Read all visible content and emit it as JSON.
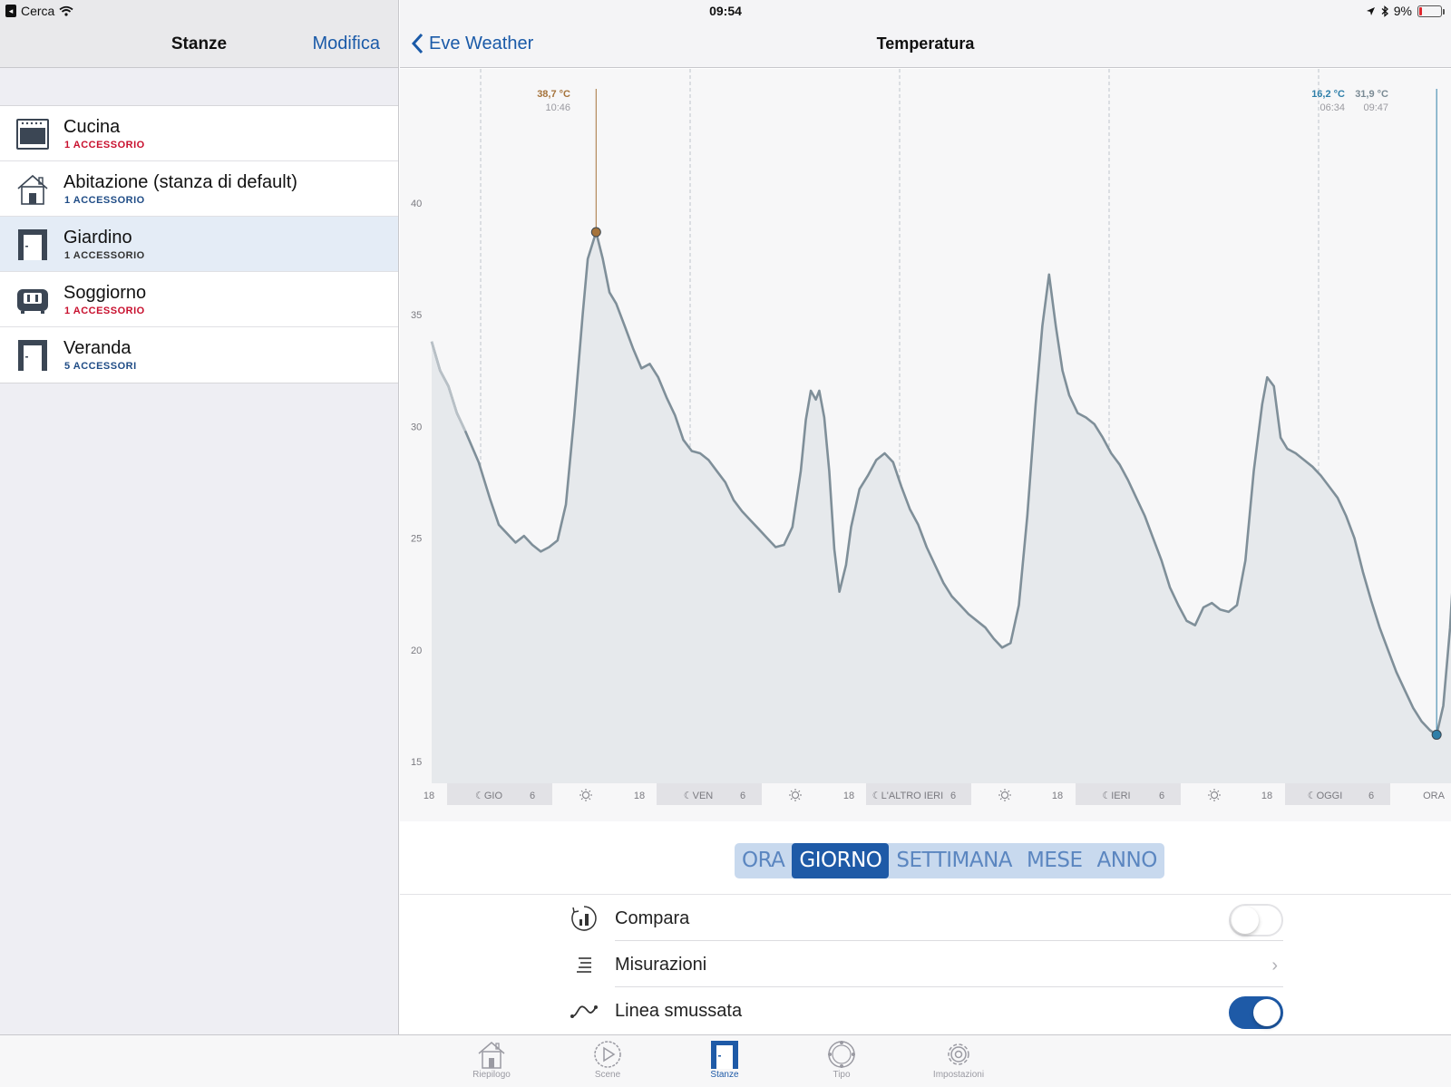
{
  "status": {
    "carrier_back": "Cerca",
    "time": "09:54",
    "battery_pct": "9%"
  },
  "left": {
    "title": "Stanze",
    "edit": "Modifica",
    "rooms": [
      {
        "name": "Cucina",
        "sub": "1 ACCESSORIO",
        "icon": "oven-icon"
      },
      {
        "name": "Abitazione (stanza di default)",
        "sub": "1 ACCESSORIO",
        "icon": "house-icon"
      },
      {
        "name": "Giardino",
        "sub": "1 ACCESSORIO",
        "icon": "door-icon"
      },
      {
        "name": "Soggiorno",
        "sub": "1 ACCESSORIO",
        "icon": "sofa-icon"
      },
      {
        "name": "Veranda",
        "sub": "5 ACCESSORI",
        "icon": "door-icon"
      }
    ]
  },
  "right": {
    "back_label": "Eve Weather",
    "title": "Temperatura"
  },
  "chart_data": {
    "type": "area",
    "ylim": [
      14,
      45
    ],
    "yticks": [
      15,
      20,
      25,
      30,
      35,
      40
    ],
    "x_labels": [
      "18",
      "GIO",
      "6",
      "18",
      "VEN",
      "6",
      "18",
      "L'ALTRO IERI",
      "6",
      "18",
      "IERI",
      "6",
      "18",
      "OGGI",
      "6",
      "ORA"
    ],
    "x_unit": "hours",
    "series": [
      {
        "values": [
          [
            0,
            33.8
          ],
          [
            0.5,
            32.5
          ],
          [
            1,
            31.8
          ],
          [
            1.5,
            30.6
          ],
          [
            2,
            29.8
          ],
          [
            2.8,
            28.4
          ],
          [
            3.5,
            26.7
          ],
          [
            4,
            25.6
          ],
          [
            4.5,
            25.2
          ],
          [
            5,
            24.8
          ],
          [
            5.5,
            25.1
          ],
          [
            6,
            24.7
          ],
          [
            6.5,
            24.4
          ],
          [
            7,
            24.6
          ],
          [
            7.5,
            24.9
          ],
          [
            8,
            26.5
          ],
          [
            8.5,
            30.5
          ],
          [
            9,
            35
          ],
          [
            9.3,
            37.5
          ],
          [
            9.8,
            38.7
          ],
          [
            10.2,
            37.5
          ],
          [
            10.6,
            36
          ],
          [
            11,
            35.5
          ],
          [
            11.5,
            34.5
          ],
          [
            12,
            33.5
          ],
          [
            12.5,
            32.6
          ],
          [
            13,
            32.8
          ],
          [
            13.5,
            32.2
          ],
          [
            14,
            31.3
          ],
          [
            14.5,
            30.5
          ],
          [
            15,
            29.4
          ],
          [
            15.5,
            28.9
          ],
          [
            16,
            28.8
          ],
          [
            16.5,
            28.5
          ],
          [
            17,
            28
          ],
          [
            17.5,
            27.5
          ],
          [
            18,
            26.7
          ],
          [
            18.5,
            26.2
          ],
          [
            19,
            25.8
          ],
          [
            19.5,
            25.4
          ],
          [
            20,
            25
          ],
          [
            20.5,
            24.6
          ],
          [
            21,
            24.7
          ],
          [
            21.5,
            25.5
          ],
          [
            22,
            28
          ],
          [
            22.3,
            30.3
          ],
          [
            22.6,
            31.6
          ],
          [
            22.9,
            31.2
          ],
          [
            23.1,
            31.6
          ],
          [
            23.4,
            30.4
          ],
          [
            23.7,
            28
          ],
          [
            24,
            24.5
          ],
          [
            24.3,
            22.6
          ],
          [
            24.7,
            23.8
          ],
          [
            25,
            25.5
          ],
          [
            25.5,
            27.2
          ],
          [
            26,
            27.8
          ],
          [
            26.5,
            28.5
          ],
          [
            27,
            28.8
          ],
          [
            27.5,
            28.4
          ],
          [
            28,
            27.3
          ],
          [
            28.5,
            26.3
          ],
          [
            29,
            25.6
          ],
          [
            29.5,
            24.6
          ],
          [
            30,
            23.8
          ],
          [
            30.5,
            23
          ],
          [
            31,
            22.4
          ],
          [
            31.5,
            22
          ],
          [
            32,
            21.6
          ],
          [
            32.5,
            21.3
          ],
          [
            33,
            21
          ],
          [
            33.5,
            20.5
          ],
          [
            34,
            20.1
          ],
          [
            34.5,
            20.3
          ],
          [
            35,
            22
          ],
          [
            35.5,
            26
          ],
          [
            36,
            31
          ],
          [
            36.4,
            34.5
          ],
          [
            36.8,
            36.8
          ],
          [
            37.2,
            34.5
          ],
          [
            37.6,
            32.5
          ],
          [
            38,
            31.4
          ],
          [
            38.5,
            30.6
          ],
          [
            39,
            30.4
          ],
          [
            39.5,
            30.1
          ],
          [
            40,
            29.5
          ],
          [
            40.5,
            28.8
          ],
          [
            41,
            28.3
          ],
          [
            41.5,
            27.6
          ],
          [
            42,
            26.8
          ],
          [
            42.5,
            26
          ],
          [
            43,
            25
          ],
          [
            43.5,
            24
          ],
          [
            44,
            22.8
          ],
          [
            44.5,
            22
          ],
          [
            45,
            21.3
          ],
          [
            45.5,
            21.1
          ],
          [
            46,
            21.9
          ],
          [
            46.5,
            22.1
          ],
          [
            47,
            21.8
          ],
          [
            47.5,
            21.7
          ],
          [
            48,
            22
          ],
          [
            48.5,
            24
          ],
          [
            49,
            28
          ],
          [
            49.5,
            31
          ],
          [
            49.8,
            32.2
          ],
          [
            50.2,
            31.8
          ],
          [
            50.6,
            29.5
          ],
          [
            51,
            29
          ],
          [
            51.5,
            28.8
          ],
          [
            52,
            28.5
          ],
          [
            52.5,
            28.2
          ],
          [
            53,
            27.8
          ],
          [
            53.5,
            27.3
          ],
          [
            54,
            26.8
          ],
          [
            54.5,
            26
          ],
          [
            55,
            25
          ],
          [
            55.5,
            23.5
          ],
          [
            56,
            22.2
          ],
          [
            56.5,
            21
          ],
          [
            57,
            20
          ],
          [
            57.5,
            19
          ],
          [
            58,
            18.2
          ],
          [
            58.5,
            17.4
          ],
          [
            59,
            16.8
          ],
          [
            59.5,
            16.4
          ],
          [
            59.9,
            16.2
          ],
          [
            60.3,
            17.5
          ],
          [
            60.7,
            21
          ],
          [
            61.1,
            26
          ],
          [
            61.5,
            29.8
          ],
          [
            61.8,
            31.9
          ]
        ]
      }
    ],
    "markers": [
      {
        "label": "38,7 °C",
        "time": "10:46",
        "x": 9.8,
        "y": 38.7,
        "color": "#a5733b"
      },
      {
        "label": "16,2 °C",
        "time": "06:34",
        "x": 59.9,
        "y": 16.2,
        "color": "#2f7fa9"
      },
      {
        "label": "31,9 °C",
        "time": "09:47",
        "x": 61.8,
        "y": 31.9,
        "color": "#7a8a94"
      }
    ],
    "colors": {
      "line": "#7f8f99",
      "line_early": "#b8c0c6",
      "fill": "#e6e9ec",
      "grid": "#bfc6cc"
    }
  },
  "segments": {
    "items": [
      "ORA",
      "GIORNO",
      "SETTIMANA",
      "MESE",
      "ANNO"
    ],
    "active": "GIORNO"
  },
  "settings": [
    {
      "label": "Compara",
      "control": "toggle-off"
    },
    {
      "label": "Misurazioni",
      "control": "chevron"
    },
    {
      "label": "Linea smussata",
      "control": "toggle-on"
    }
  ],
  "tabbar": {
    "items": [
      {
        "label": "Riepilogo",
        "icon": "home-icon"
      },
      {
        "label": "Scene",
        "icon": "play-icon"
      },
      {
        "label": "Stanze",
        "icon": "door-icon"
      },
      {
        "label": "Tipo",
        "icon": "ring-icon"
      },
      {
        "label": "Impostazioni",
        "icon": "gear-icon"
      }
    ],
    "active": "Stanze"
  }
}
